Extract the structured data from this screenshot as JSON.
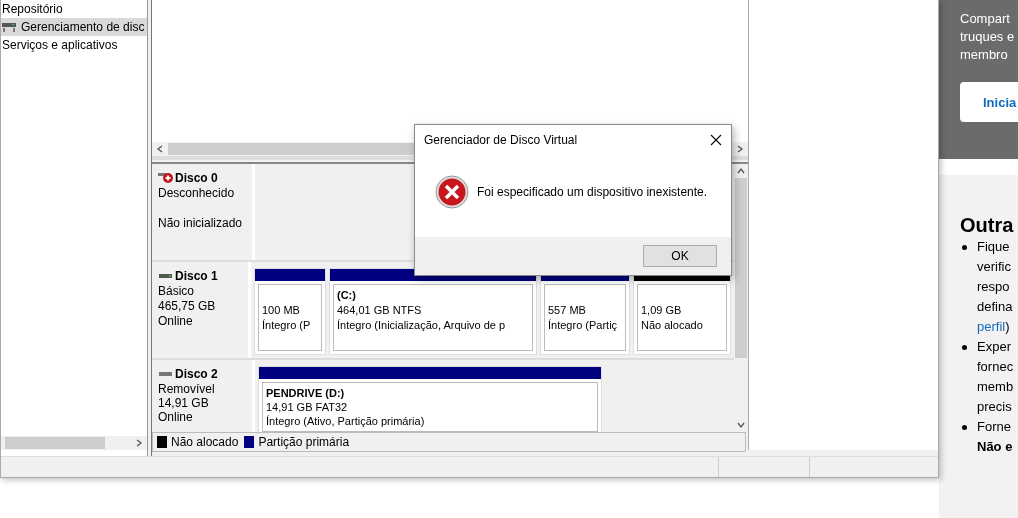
{
  "tree": {
    "items": [
      {
        "label": "Repositório",
        "selected": false
      },
      {
        "label": "Gerenciamento de disc",
        "selected": true
      },
      {
        "label": "Serviços e aplicativos",
        "selected": false
      }
    ]
  },
  "disks": [
    {
      "name": "Disco 0",
      "kind": "unknown",
      "type": "Desconhecido",
      "state": "Não inicializado"
    },
    {
      "name": "Disco 1",
      "kind": "basic",
      "type": "Básico",
      "size": "465,75 GB",
      "state": "Online",
      "partitions": [
        {
          "kind": "primary",
          "size": "100 MB",
          "status": "Íntegro (P"
        },
        {
          "kind": "primary",
          "label": "(C:)",
          "size": "464,01 GB NTFS",
          "status": "Íntegro (Inicialização, Arquivo de p"
        },
        {
          "kind": "primary",
          "size": "557 MB",
          "status": "Íntegro (Partiç"
        },
        {
          "kind": "unallocated",
          "size": "1,09 GB",
          "status": "Não alocado"
        }
      ]
    },
    {
      "name": "Disco 2",
      "kind": "removable",
      "type": "Removível",
      "size": "14,91 GB",
      "state": "Online",
      "partitions": [
        {
          "kind": "primary",
          "label": "PENDRIVE  (D:)",
          "size": "14,91 GB FAT32",
          "status": "Íntegro (Ativo, Partição primária)"
        }
      ]
    }
  ],
  "legend": [
    {
      "label": "Não alocado",
      "color": "#000000"
    },
    {
      "label": "Partição primária",
      "color": "#000080"
    }
  ],
  "dialog": {
    "title": "Gerenciador de Disco Virtual",
    "message": "Foi especificado um dispositivo inexistente.",
    "button": "OK"
  },
  "web": {
    "banner_lines": [
      "Compart",
      "truques e",
      "membro"
    ],
    "button": "Inicia",
    "heading": "Outra",
    "bullets": [
      {
        "lines": [
          [
            {
              "text": "Fique",
              "kind": "text"
            }
          ],
          [
            {
              "text": "verific",
              "kind": "text"
            }
          ],
          [
            {
              "text": "respo",
              "kind": "text"
            }
          ],
          [
            {
              "text": "defina",
              "kind": "text"
            }
          ],
          [
            {
              "text": "perfil",
              "kind": "link"
            },
            {
              "text": ")",
              "kind": "text"
            }
          ]
        ]
      },
      {
        "lines": [
          [
            {
              "text": "Exper",
              "kind": "text"
            }
          ],
          [
            {
              "text": "fornec",
              "kind": "text"
            }
          ],
          [
            {
              "text": "memb",
              "kind": "text"
            }
          ],
          [
            {
              "text": "precis",
              "kind": "text"
            }
          ]
        ]
      },
      {
        "lines": [
          [
            {
              "text": "Forne",
              "kind": "text"
            }
          ],
          [
            {
              "text": "Não e",
              "kind": "bold"
            }
          ]
        ]
      }
    ]
  }
}
